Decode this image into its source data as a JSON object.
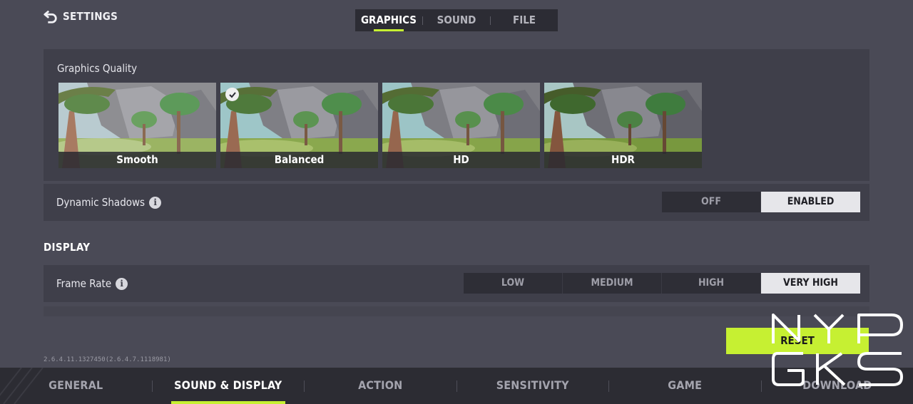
{
  "header": {
    "back_label": "SETTINGS",
    "tabs": [
      {
        "label": "GRAPHICS",
        "active": true
      },
      {
        "label": "SOUND",
        "active": false
      },
      {
        "label": "FILE",
        "active": false
      }
    ]
  },
  "graphics_quality": {
    "title": "Graphics Quality",
    "options": [
      {
        "label": "Smooth",
        "selected": false
      },
      {
        "label": "Balanced",
        "selected": true
      },
      {
        "label": "HD",
        "selected": false
      },
      {
        "label": "HDR",
        "selected": false
      }
    ]
  },
  "dynamic_shadows": {
    "label": "Dynamic Shadows",
    "options": [
      {
        "label": "OFF",
        "active": false
      },
      {
        "label": "ENABLED",
        "active": true
      }
    ]
  },
  "display": {
    "section_title": "DISPLAY",
    "frame_rate": {
      "label": "Frame Rate",
      "options": [
        {
          "label": "LOW",
          "active": false
        },
        {
          "label": "MEDIUM",
          "active": false
        },
        {
          "label": "HIGH",
          "active": false
        },
        {
          "label": "VERY HIGH",
          "active": true
        }
      ]
    }
  },
  "reset_label": "RESET",
  "version": "2.6.4.11.1327450(2.6.4.7.1118981)",
  "bottom_nav": [
    {
      "label": "GENERAL",
      "active": false
    },
    {
      "label": "SOUND & DISPLAY",
      "active": true
    },
    {
      "label": "ACTION",
      "active": false
    },
    {
      "label": "SENSITIVITY",
      "active": false
    },
    {
      "label": "GAME",
      "active": false
    },
    {
      "label": "DOWNLOAD",
      "active": false
    }
  ],
  "colors": {
    "accent": "#c6f032",
    "background": "#4a4a56",
    "panel": "#3f3f4a"
  },
  "icons": {
    "back": "back-arrow-icon",
    "info": "info-icon",
    "check": "check-icon"
  }
}
